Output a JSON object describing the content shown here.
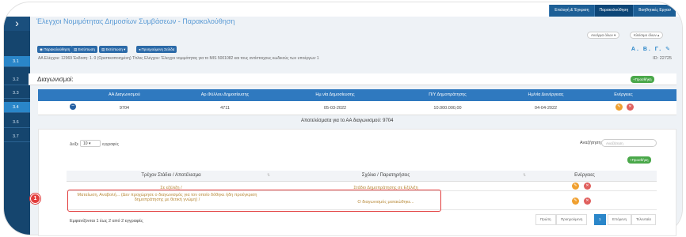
{
  "topnav": [
    "Επιλογή & Έγκριση",
    "Παρακολούθηση",
    "Βοηθητικές Εργασ"
  ],
  "sidebar": {
    "toggle": "›",
    "items": [
      "3.1",
      "3.2",
      "3.3",
      "3.4",
      "3.6",
      "3.7"
    ]
  },
  "page_title": "Έλεγχοι Νομιμότητας Δημοσίων Συμβάσεων - Παρακολούθηση",
  "dropdowns": {
    "actions": "Ανοίγμα όλων",
    "close": "Κλείσιμο όλων"
  },
  "toolbar": [
    "Παρακολούθηση",
    "Εκτύπωση",
    "Εκτύπωση",
    "Προηγούμενη Σελίδα"
  ],
  "letters": "Α. Β. Γ.",
  "info_line": "ΑΑ Ελέγχου: 12969   Έκδοση: 1. 0 (Οριστικοποιημένη)   Τίτλος Ελέγχου: Έλεγχοι νομιμότητας για το MIS 5001082 και τους αντίστοιχους κωδικούς των υποέργων 1",
  "info_id": "ID: 22725",
  "section_title": "Διαγωνισμοί:",
  "add_label": "Προσθήκη",
  "table": {
    "headers": [
      "ΑΑ Διαγωνισμού",
      "Αρ.Φύλλου Δημοσίευσης",
      "Ημ.νία Δημοσίευσης",
      "Π/Υ Δημοπράτησης",
      "Ημ/νία Διενέργειας",
      "Ενέργειες"
    ],
    "row": [
      "9704",
      "4711",
      "05-03-2022",
      "10.000.000,00",
      "04-04-2022"
    ]
  },
  "results_caption": "Αποτελέσματα για το ΑΑ διαγωνισμού: 9704",
  "show": {
    "prefix": "Δείξε",
    "value": "10",
    "suffix": "εγγραφές"
  },
  "search": {
    "label": "Αναζήτηση:",
    "placeholder": "Αναζήτηση"
  },
  "sub_table": {
    "headers": [
      "Τρέχον Στάδιο / Αποτέλεσμα",
      "Σχόλια / Παρατηρήσεις",
      "Ενέργειες"
    ],
    "rows": [
      {
        "stage": "Σε εξέλιξη /",
        "comment": "Στάδιο Δημοπράτησης σε Εξέλιξη"
      },
      {
        "stage": "Ματαίωση, Αναβολή... (Δεν προχώρησε ο διαγωνισμός για τον οποίο δόθηκε ήδη προέγκριση δημοπράτησης με θετική γνώμη) /",
        "comment": "Ο διαγωνισμός ματαιώθηκε..."
      }
    ]
  },
  "annotation": "1",
  "footer_info": "Εμφανίζονται 1 έως 2 από 2 εγγραφές",
  "pager": [
    "Πρώτη",
    "Προηγούμενη",
    "1",
    "Επόμενη",
    "Τελευταία"
  ]
}
